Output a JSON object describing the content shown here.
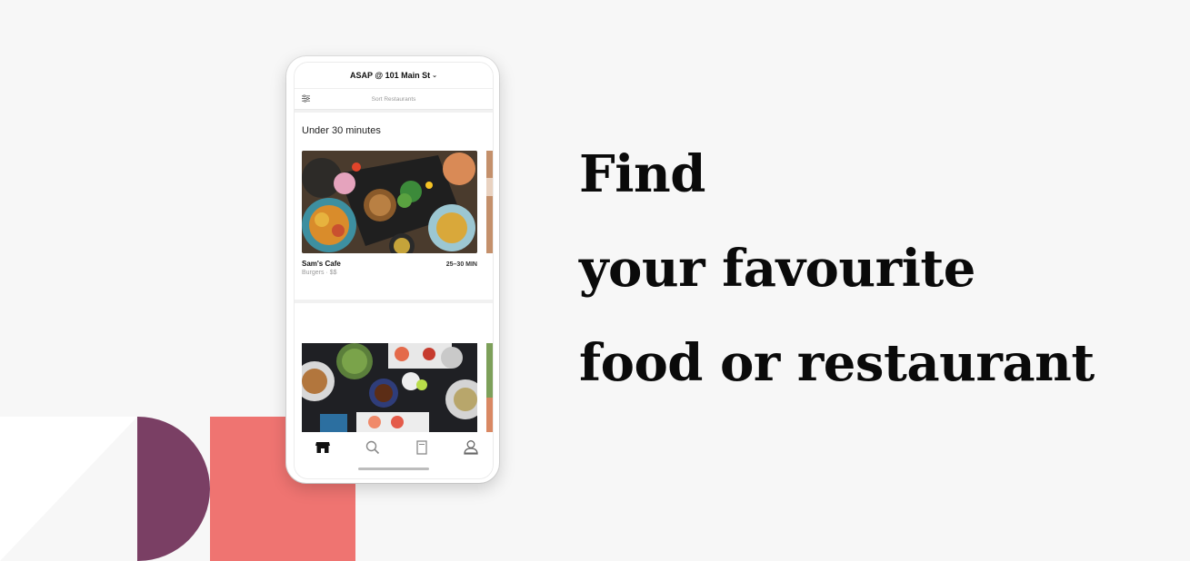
{
  "app": {
    "location_label": "ASAP @ 101 Main St",
    "sort_label": "Sort Restaurants"
  },
  "section": {
    "title": "Under 30 minutes"
  },
  "restaurant": {
    "name": "Sam's Cafe",
    "category": "Burgers · $$",
    "eta": "25–30 MIN"
  },
  "tabs": [
    {
      "icon": "store-icon",
      "active": true
    },
    {
      "icon": "search-icon",
      "active": false
    },
    {
      "icon": "orders-icon",
      "active": false
    },
    {
      "icon": "account-icon",
      "active": false
    }
  ],
  "headline": {
    "line1": "Find",
    "line2": "your favourite",
    "line3": "food or restaurant"
  },
  "colors": {
    "background": "#f7f7f7",
    "deco_purple": "#7a3f64",
    "deco_coral": "#ef7471",
    "text": "#0a0a0a"
  }
}
